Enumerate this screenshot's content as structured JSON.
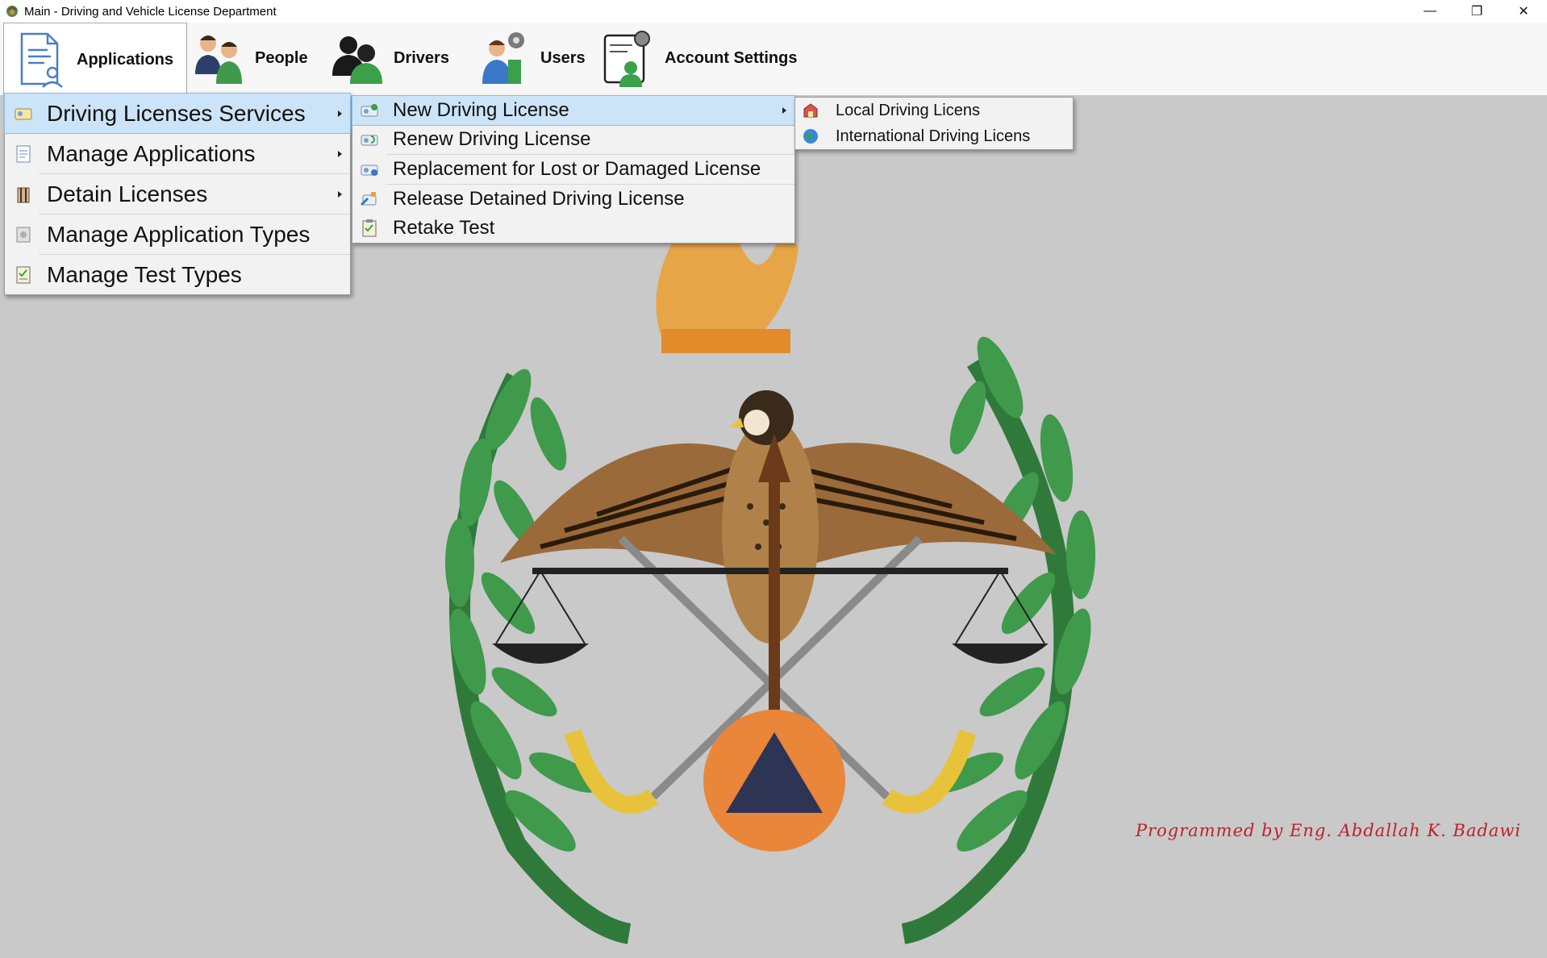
{
  "window": {
    "title": "Main - Driving and Vehicle License Department",
    "minimize_glyph": "—",
    "restore_glyph": "❐",
    "close_glyph": "✕"
  },
  "menubar": {
    "items": [
      {
        "label": "Applications",
        "icon": "applications-document-icon"
      },
      {
        "label": "People",
        "icon": "people-group-icon"
      },
      {
        "label": "Drivers",
        "icon": "drivers-group-icon"
      },
      {
        "label": "Users",
        "icon": "users-settings-icon"
      },
      {
        "label": "Account Settings",
        "icon": "account-settings-icon"
      }
    ],
    "active": "Applications"
  },
  "applications_menu": {
    "items": [
      {
        "label": "Driving Licenses Services",
        "icon": "license-card-icon",
        "has_submenu": true,
        "highlighted": true
      },
      {
        "label": "Manage Applications",
        "icon": "applications-list-icon",
        "has_submenu": true
      },
      {
        "label": "Detain Licenses",
        "icon": "detain-icon",
        "has_submenu": true
      },
      {
        "label": "Manage Application Types",
        "icon": "application-types-icon",
        "has_submenu": false
      },
      {
        "label": "Manage Test Types",
        "icon": "test-types-icon",
        "has_submenu": false
      }
    ]
  },
  "services_menu": {
    "items": [
      {
        "label": "New Driving License",
        "icon": "new-license-icon",
        "has_submenu": true,
        "highlighted": true
      },
      {
        "label": "Renew Driving License",
        "icon": "renew-license-icon"
      },
      {
        "label": "Replacement for Lost or Damaged License",
        "icon": "replacement-license-icon"
      },
      {
        "label": "Release Detained Driving License",
        "icon": "release-license-icon"
      },
      {
        "label": "Retake Test",
        "icon": "retake-test-icon"
      }
    ]
  },
  "new_license_menu": {
    "items": [
      {
        "label": "Local Driving Licens",
        "icon": "local-license-icon"
      },
      {
        "label": "International Driving Licens",
        "icon": "globe-icon"
      }
    ]
  },
  "footer": {
    "credit": "Programmed by Eng. Abdallah K. Badawi"
  },
  "colors": {
    "background": "#c9c9c9",
    "highlight": "#cce4f7",
    "credit": "#c0202a",
    "wreath": "#3a8a45",
    "orange": "#e9863a"
  }
}
